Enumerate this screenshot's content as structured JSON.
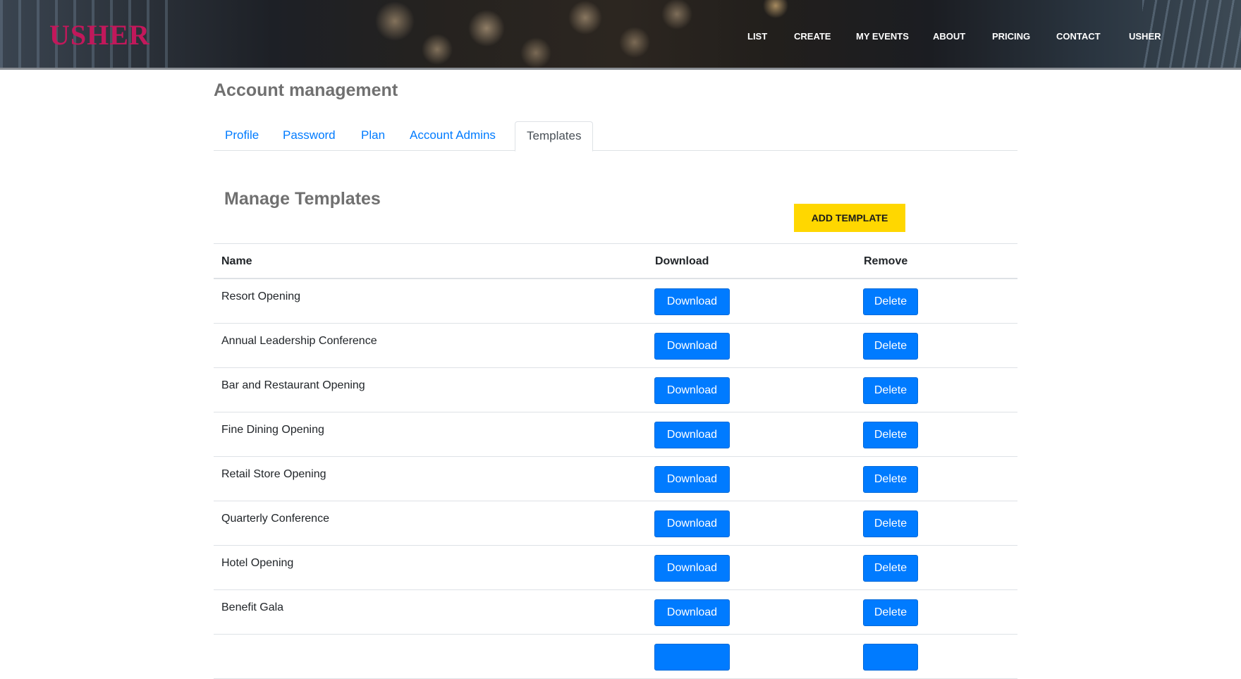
{
  "brand": {
    "logo": "USHER"
  },
  "nav": {
    "items": [
      {
        "label": "LIST"
      },
      {
        "label": "CREATE"
      },
      {
        "label": "MY EVENTS"
      },
      {
        "label": "ABOUT"
      },
      {
        "label": "PRICING"
      },
      {
        "label": "CONTACT"
      },
      {
        "label": "USHER"
      }
    ]
  },
  "page": {
    "title": "Account management"
  },
  "tabs": [
    {
      "label": "Profile",
      "active": false
    },
    {
      "label": "Password",
      "active": false
    },
    {
      "label": "Plan",
      "active": false
    },
    {
      "label": "Account Admins",
      "active": false
    },
    {
      "label": "Templates",
      "active": true
    }
  ],
  "templates": {
    "title": "Manage Templates",
    "add_button": "ADD TEMPLATE",
    "columns": {
      "name": "Name",
      "download": "Download",
      "remove": "Remove"
    },
    "download_label": "Download",
    "delete_label": "Delete",
    "rows": [
      {
        "name": "Resort Opening"
      },
      {
        "name": "Annual Leadership Conference"
      },
      {
        "name": "Bar and Restaurant Opening"
      },
      {
        "name": "Fine Dining Opening"
      },
      {
        "name": "Retail Store Opening"
      },
      {
        "name": "Quarterly Conference"
      },
      {
        "name": "Hotel Opening"
      },
      {
        "name": "Benefit Gala"
      }
    ]
  },
  "colors": {
    "brand": "#c2185b",
    "accent_yellow": "#ffd700",
    "primary_blue": "#007bff",
    "heading_gray": "#707070"
  }
}
